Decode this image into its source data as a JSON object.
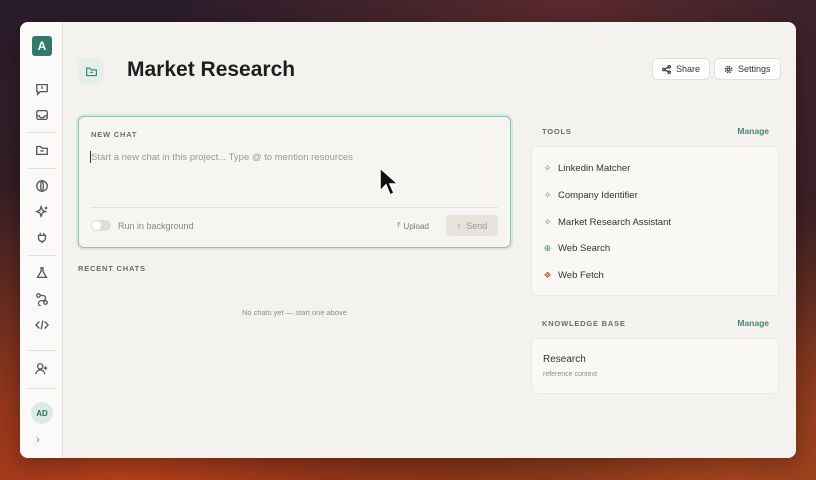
{
  "app": {
    "logo_letter": "A"
  },
  "rail": {
    "icons": [
      "chat-icon",
      "inbox-icon",
      "folder-icon",
      "globe-icon",
      "sparkle-icon",
      "plug-icon",
      "flask-icon",
      "route-icon",
      "code-icon",
      "add-user-icon"
    ],
    "avatar": "AD",
    "expand": "›"
  },
  "header": {
    "title": "Market Research",
    "share_label": "Share",
    "settings_label": "Settings"
  },
  "new_chat": {
    "label": "NEW CHAT",
    "placeholder": "Start a new chat in this project... Type @ to mention resources",
    "background_label": "Run in background",
    "upload_label": "Upload",
    "send_label": "Send"
  },
  "recent": {
    "label": "RECENT CHATS",
    "empty_text": "No chats yet — start one above"
  },
  "tools": {
    "label": "TOOLS",
    "manage_label": "Manage",
    "items": [
      {
        "label": "Linkedin Matcher",
        "icon": "sparkle-icon",
        "color": "#3e8a78"
      },
      {
        "label": "Company Identifier",
        "icon": "sparkle-icon",
        "color": "#3e8a78"
      },
      {
        "label": "Market Research Assistant",
        "icon": "sparkle-icon",
        "color": "#3e8a78"
      },
      {
        "label": "Web Search",
        "icon": "globe-icon",
        "color": "#3e8a78"
      },
      {
        "label": "Web Fetch",
        "icon": "fetch-icon",
        "color": "#c0603a"
      }
    ]
  },
  "knowledge": {
    "label": "KNOWLEDGE BASE",
    "manage_label": "Manage",
    "item_title": "Research",
    "item_subtitle": "reference context"
  },
  "colors": {
    "accent": "#3e8a78",
    "logo_bg": "#2f7a6c"
  }
}
